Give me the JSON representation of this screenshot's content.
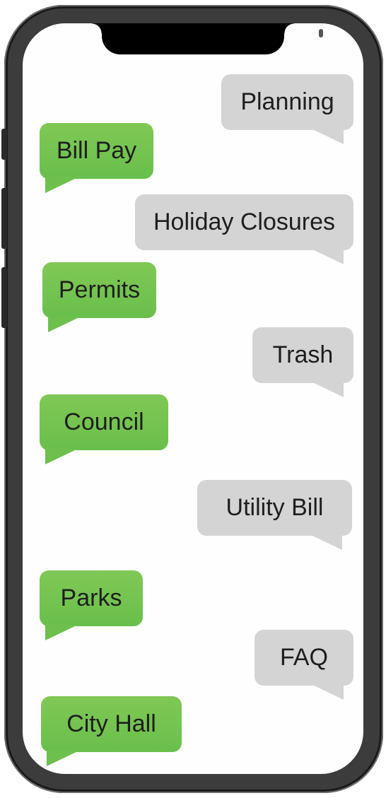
{
  "bubbles": [
    {
      "label": "Planning",
      "side": "right"
    },
    {
      "label": "Bill Pay",
      "side": "left"
    },
    {
      "label": "Holiday Closures",
      "side": "right"
    },
    {
      "label": "Permits",
      "side": "left"
    },
    {
      "label": "Trash",
      "side": "right"
    },
    {
      "label": "Council",
      "side": "left"
    },
    {
      "label": "Utility Bill",
      "side": "right"
    },
    {
      "label": "Parks",
      "side": "left"
    },
    {
      "label": "FAQ",
      "side": "right"
    },
    {
      "label": "City Hall",
      "side": "left"
    }
  ],
  "colors": {
    "gray_bubble": "#d4d4d4",
    "green_bubble": "#6dc04e",
    "phone_frame": "#3c3c3c"
  }
}
